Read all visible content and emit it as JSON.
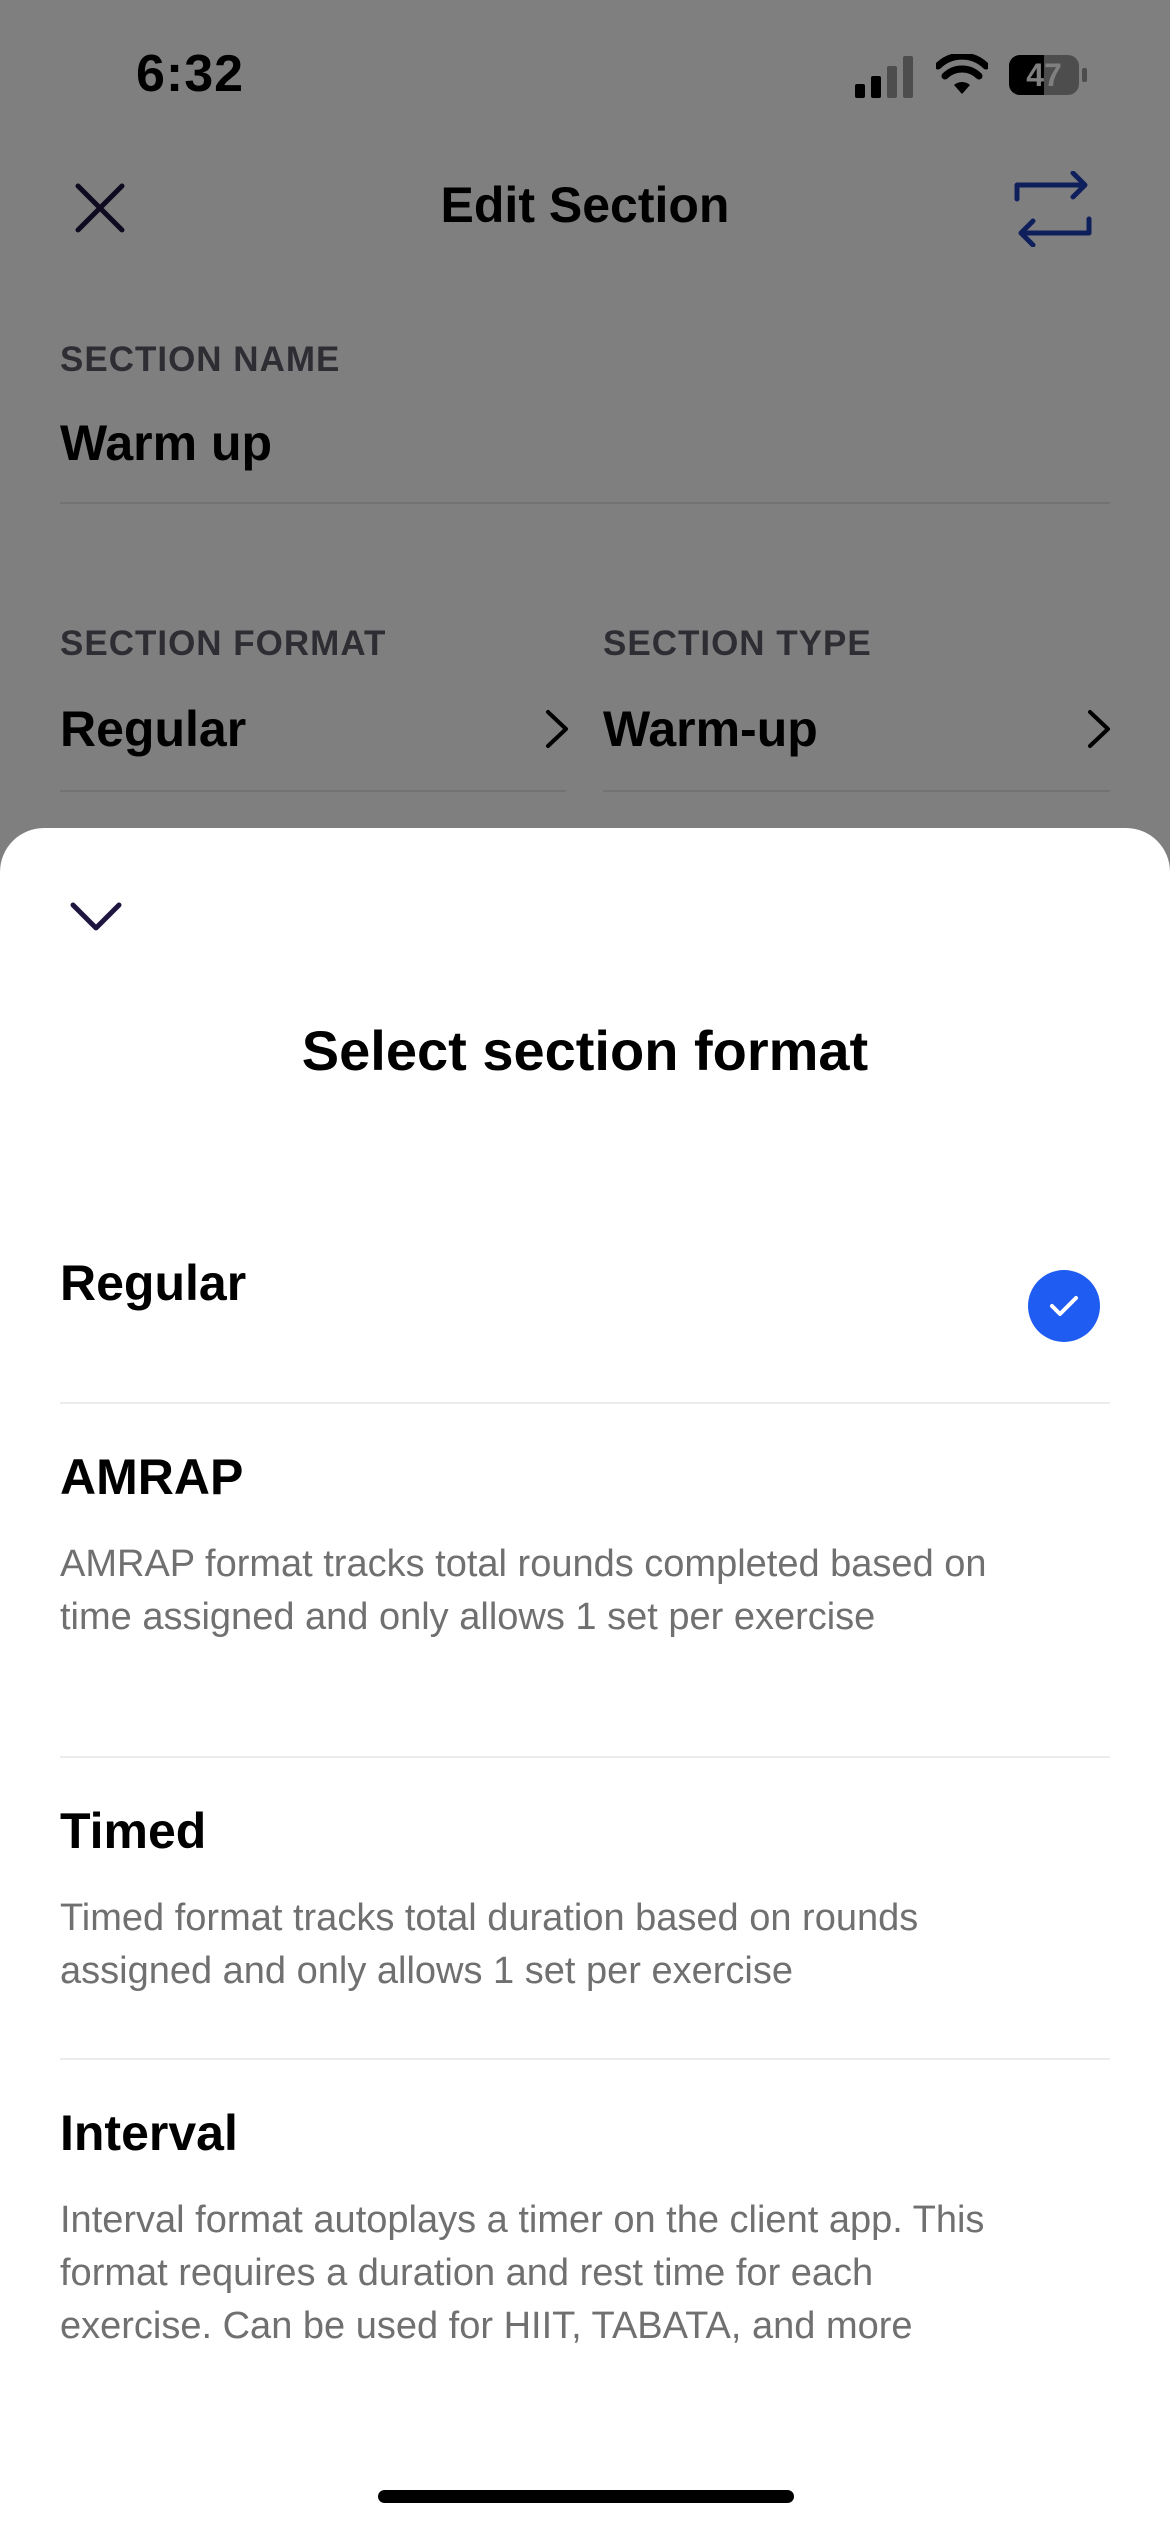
{
  "status_bar": {
    "time": "6:32",
    "battery": "47"
  },
  "header": {
    "title": "Edit Section"
  },
  "form": {
    "section_name_label": "SECTION NAME",
    "section_name_value": "Warm up",
    "section_format_label": "SECTION FORMAT",
    "section_format_value": "Regular",
    "section_type_label": "SECTION TYPE",
    "section_type_value": "Warm-up"
  },
  "sheet": {
    "title": "Select section format",
    "selected": "Regular",
    "options": [
      {
        "title": "Regular",
        "description": ""
      },
      {
        "title": "AMRAP",
        "description": "AMRAP format tracks total rounds completed based on time assigned and only allows 1 set per exercise"
      },
      {
        "title": "Timed",
        "description": "Timed format tracks total duration based on rounds assigned and only allows 1 set per exercise"
      },
      {
        "title": "Interval",
        "description": "Interval format autoplays a timer on the client app. This format requires a duration and rest time for each exercise. Can be used for HIIT, TABATA, and more"
      }
    ]
  },
  "colors": {
    "accent": "#1f5cf2",
    "icon_dark": "#1e1540",
    "overlay": "rgba(0,0,0,0.5)"
  }
}
